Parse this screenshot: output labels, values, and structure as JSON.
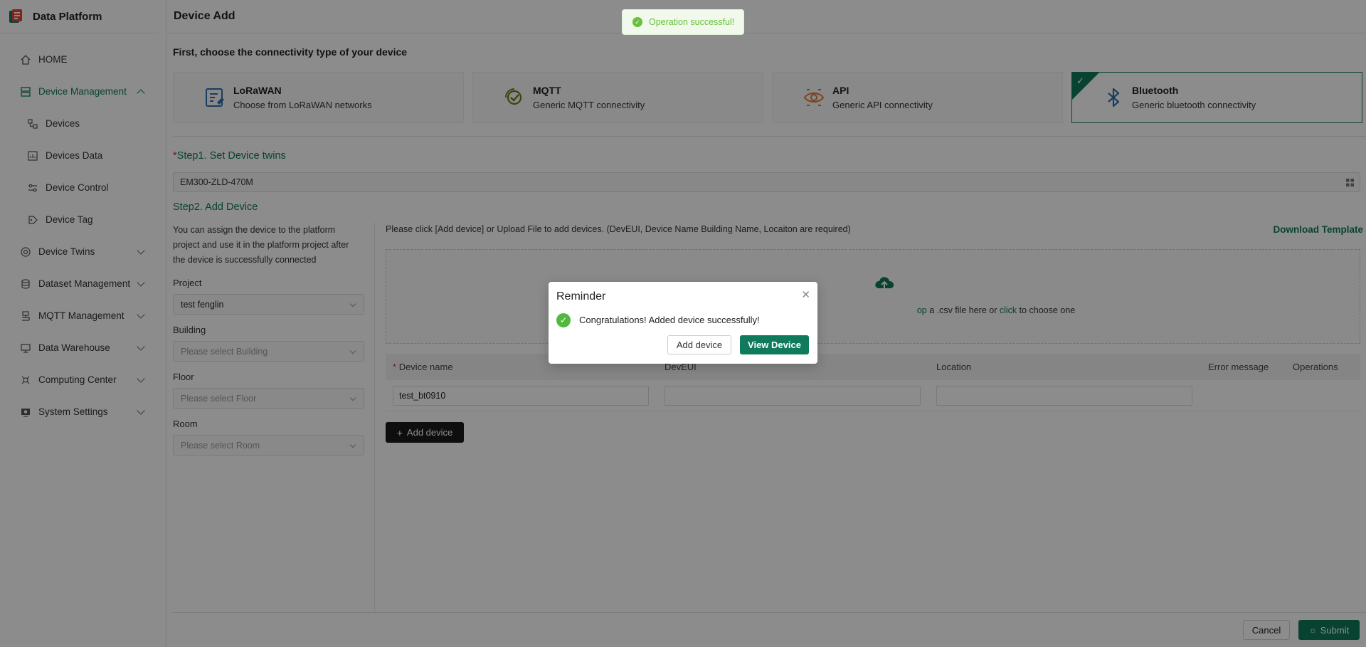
{
  "brand": {
    "name": "Data Platform"
  },
  "sidebar": {
    "items": [
      {
        "label": "HOME",
        "icon": "home-icon"
      },
      {
        "label": "Device Management",
        "icon": "device-management-icon",
        "active": true,
        "expanded": true
      },
      {
        "label": "Devices",
        "icon": "devices-icon"
      },
      {
        "label": "Devices Data",
        "icon": "devices-data-icon"
      },
      {
        "label": "Device Control",
        "icon": "device-control-icon"
      },
      {
        "label": "Device Tag",
        "icon": "device-tag-icon"
      },
      {
        "label": "Device Twins",
        "icon": "device-twins-icon"
      },
      {
        "label": "Dataset Management",
        "icon": "dataset-icon"
      },
      {
        "label": "MQTT Management",
        "icon": "mqtt-icon"
      },
      {
        "label": "Data Warehouse",
        "icon": "warehouse-icon"
      },
      {
        "label": "Computing Center",
        "icon": "computing-icon"
      },
      {
        "label": "System Settings",
        "icon": "settings-icon"
      }
    ]
  },
  "page": {
    "title": "Device Add",
    "connectivity_title": "First, choose the connectivity type of your device",
    "connectivity": [
      {
        "name": "LoRaWAN",
        "desc": "Choose from LoRaWAN networks",
        "icon": "lorawan-icon"
      },
      {
        "name": "MQTT",
        "desc": "Generic MQTT connectivity",
        "icon": "mqtt-icon"
      },
      {
        "name": "API",
        "desc": "Generic API connectivity",
        "icon": "api-icon"
      },
      {
        "name": "Bluetooth",
        "desc": "Generic bluetooth connectivity",
        "icon": "bluetooth-icon",
        "selected": true
      }
    ],
    "step1": {
      "req": "*",
      "title": "Step1. Set Device twins",
      "value": "EM300-ZLD-470M"
    },
    "step2": {
      "title": "Step2. Add Device",
      "assign_text": "You can assign the device to the platform project and use it in the platform project after the device is successfully connected",
      "project_label": "Project",
      "project_value": "test fenglin",
      "building_label": "Building",
      "building_placeholder": "Please select Building",
      "floor_label": "Floor",
      "floor_placeholder": "Please select Floor",
      "room_label": "Room",
      "room_placeholder": "Please select Room",
      "instruction": "Please click [Add device] or Upload File to add devices. (DevEUI, Device Name Building Name, Locaiton are required)",
      "download_template": "Download Template",
      "upload_text_a": "op",
      "upload_text_b": " a .csv file here or ",
      "upload_text_link": "click",
      "upload_text_c": " to choose one",
      "table": {
        "headers": {
          "req": "*",
          "device_name": "Device name",
          "deveui": "DevEUI",
          "location": "Location",
          "error": "Error message",
          "operations": "Operations"
        },
        "rows": [
          {
            "device_name": "test_bt0910",
            "deveui": "",
            "location": ""
          }
        ]
      },
      "add_device_label": "Add device"
    },
    "cancel_label": "Cancel",
    "submit_label": "Submit"
  },
  "toast": {
    "message": "Operation successful!"
  },
  "modal": {
    "title": "Reminder",
    "message": "Congratulations! Added device successfully!",
    "add_label": "Add device",
    "view_label": "View Device"
  },
  "colors": {
    "accent": "#0f7a5c",
    "success": "#67c23a"
  }
}
